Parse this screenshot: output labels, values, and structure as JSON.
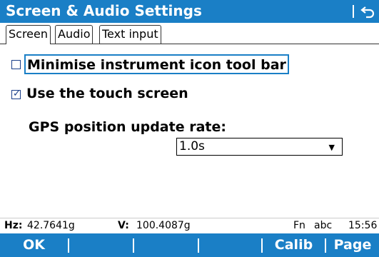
{
  "window": {
    "title": "Screen & Audio Settings",
    "back_icon": "back-arrow-icon"
  },
  "tabs": [
    {
      "label": "Screen",
      "active": true
    },
    {
      "label": "Audio",
      "active": false
    },
    {
      "label": "Text input",
      "active": false
    }
  ],
  "options": {
    "minimise_toolbar": {
      "label": "Minimise instrument icon tool bar",
      "checked": false
    },
    "touch_screen": {
      "label": "Use the touch screen",
      "checked": true
    }
  },
  "gps": {
    "label": "GPS position update rate:",
    "value": "1.0s"
  },
  "status": {
    "hz_label": "Hz:",
    "hz_value": "42.7641g",
    "v_label": "V:",
    "v_value": "100.4087g",
    "fn": "Fn",
    "input_mode": "abc",
    "time": "15:56"
  },
  "softkeys": [
    "OK",
    "",
    "",
    "",
    "Calib",
    "Page"
  ],
  "colors": {
    "accent": "#1a7fc6",
    "checkbox": "#1a3f8a"
  }
}
